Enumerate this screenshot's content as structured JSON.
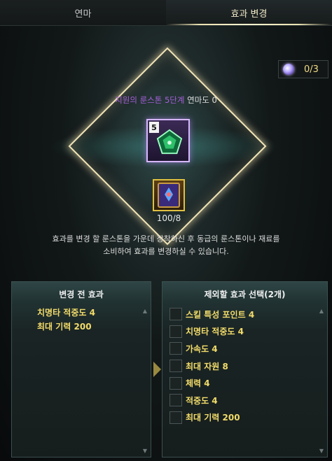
{
  "tabs": [
    {
      "label": "연마"
    },
    {
      "label": "효과 변경"
    }
  ],
  "counter": {
    "value": "0/3"
  },
  "rune": {
    "name_prefix": "지원의 룬스톤 5단계",
    "name_suffix": " 연마도 0",
    "tier": "5"
  },
  "material": {
    "count": "100/8"
  },
  "description": {
    "line1": "효과를 변경 할 룬스톤을 가운데 장착하신 후 동급의 룬스톤이나 재료를",
    "line2": "소비하여 효과를 변경하실 수 있습니다."
  },
  "left_panel": {
    "title": "변경 전 효과",
    "effects": [
      "치명타 적중도 4",
      "최대 기력 200"
    ]
  },
  "right_panel": {
    "title": "제외할 효과 선택(2개)",
    "options": [
      "스킬 특성 포인트 4",
      "치명타 적중도 4",
      "가속도 4",
      "최대 자원 8",
      "체력 4",
      "적중도 4",
      "최대 기력 200"
    ]
  },
  "colors": {
    "accent_gold": "#f1db6a",
    "accent_purple": "#a45fd8"
  }
}
